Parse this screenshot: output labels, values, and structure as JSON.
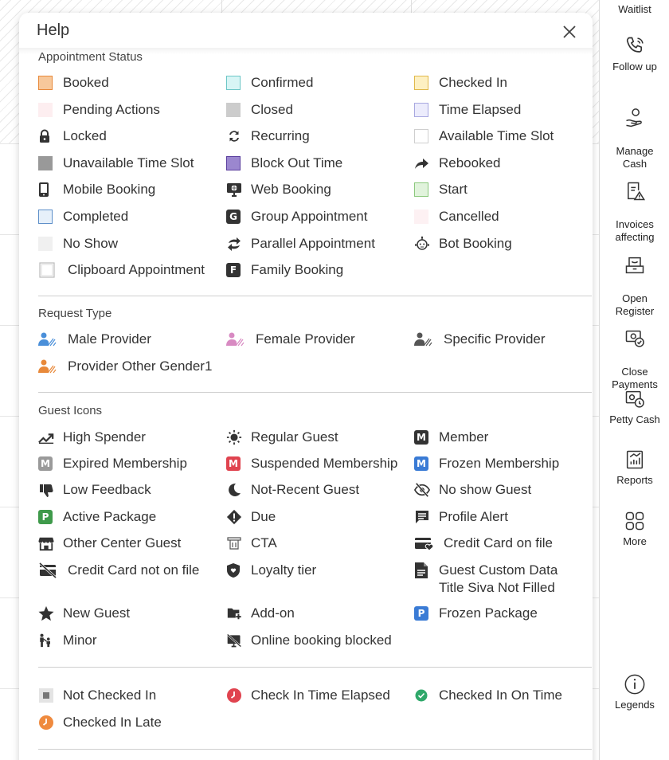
{
  "modal": {
    "title": "Help",
    "sections": {
      "appointment_status": {
        "title": "Appointment Status",
        "items": [
          {
            "label": "Booked",
            "swatch": "#f7c89b",
            "border": "#e8893a"
          },
          {
            "label": "Confirmed",
            "swatch": "#d8f5f5",
            "border": "#6cc6c6"
          },
          {
            "label": "Checked In",
            "swatch": "#fdf0c2",
            "border": "#e0b84a"
          },
          {
            "label": "Pending Actions",
            "swatch": "#fdeef0",
            "border": "#fdeef0"
          },
          {
            "label": "Closed",
            "swatch": "#cccccc",
            "border": "#cccccc"
          },
          {
            "label": "Time Elapsed",
            "swatch": "#ececfc",
            "border": "#a8a8e0"
          },
          {
            "label": "Locked",
            "icon": "lock-icon"
          },
          {
            "label": "Recurring",
            "icon": "recurring-icon"
          },
          {
            "label": "Available Time Slot",
            "swatch": "#ffffff",
            "border": "#cfcfcf"
          },
          {
            "label": "Unavailable Time Slot",
            "swatch": "#999999",
            "border": "#999999"
          },
          {
            "label": "Block Out Time",
            "swatch": "#9b87cf",
            "border": "#5b3f9e"
          },
          {
            "label": "Rebooked",
            "icon": "rebooked-arrow-icon"
          },
          {
            "label": "Mobile Booking",
            "icon": "mobile-icon"
          },
          {
            "label": "Web Booking",
            "icon": "web-monitor-icon"
          },
          {
            "label": "Start",
            "swatch": "#e1f3dc",
            "border": "#8cc87d"
          },
          {
            "label": "Completed",
            "swatch": "#e6f0fa",
            "border": "#5d8fc9"
          },
          {
            "label": "Group Appointment",
            "icon": "group-g-icon"
          },
          {
            "label": "Cancelled",
            "swatch": "#fdf1f3",
            "border": "#fdf1f3"
          },
          {
            "label": "No Show",
            "swatch": "#f0f0f0",
            "border": "#f0f0f0"
          },
          {
            "label": "Parallel Appointment",
            "icon": "parallel-arrows-icon"
          },
          {
            "label": "Bot Booking",
            "icon": "bot-icon"
          },
          {
            "label": "Clipboard Appointment",
            "icon": "clipboard-icon"
          },
          {
            "label": "Family Booking",
            "icon": "family-f-icon"
          }
        ]
      },
      "request_type": {
        "title": "Request Type",
        "items": [
          {
            "label": "Male Provider",
            "color": "#4a8fd9"
          },
          {
            "label": "Female Provider",
            "color": "#d88ac2"
          },
          {
            "label": "Specific Provider",
            "color": "#555555"
          },
          {
            "label": "Provider Other Gender1",
            "color": "#e8893a"
          }
        ]
      },
      "guest_icons": {
        "title": "Guest Icons",
        "items": [
          {
            "label": "High Spender",
            "icon": "trending-up-icon"
          },
          {
            "label": "Regular Guest",
            "icon": "sun-icon"
          },
          {
            "label": "Member",
            "icon": "member-m-icon",
            "color": "#333333",
            "letter": "M"
          },
          {
            "label": "Expired Membership",
            "icon": "expired-membership-icon",
            "color": "#9a9a9a",
            "letter": "M"
          },
          {
            "label": "Suspended Membership",
            "icon": "suspended-membership-icon",
            "color": "#e0434f",
            "letter": "M"
          },
          {
            "label": "Frozen Membership",
            "icon": "frozen-membership-icon",
            "color": "#3a7bd5",
            "letter": "M"
          },
          {
            "label": "Low Feedback",
            "icon": "thumbs-down-icon"
          },
          {
            "label": "Not-Recent Guest",
            "icon": "moon-icon"
          },
          {
            "label": "No show Guest",
            "icon": "eye-off-icon"
          },
          {
            "label": "Active Package",
            "icon": "active-package-icon",
            "color": "#3f9a4b",
            "letter": "P"
          },
          {
            "label": "Due",
            "icon": "due-alert-icon"
          },
          {
            "label": "Profile Alert",
            "icon": "comment-icon"
          },
          {
            "label": "Other Center Guest",
            "icon": "store-icon"
          },
          {
            "label": "CTA",
            "icon": "cta-icon"
          },
          {
            "label": "Credit Card on file",
            "icon": "credit-card-heart-icon"
          },
          {
            "label": "Credit Card not on file",
            "icon": "credit-card-off-icon"
          },
          {
            "label": "Loyalty tier",
            "icon": "loyalty-shield-icon"
          },
          {
            "label": "Guest Custom Data\nTitle Siva Not Filled",
            "icon": "document-icon"
          },
          {
            "label": "New Guest",
            "icon": "star-icon"
          },
          {
            "label": "Add-on",
            "icon": "add-on-icon"
          },
          {
            "label": "Frozen Package",
            "icon": "frozen-package-icon",
            "color": "#3a7bd5",
            "letter": "P"
          },
          {
            "label": "Minor",
            "icon": "minor-icon"
          },
          {
            "label": "Online booking blocked",
            "icon": "online-blocked-icon"
          }
        ]
      },
      "check_in": {
        "items": [
          {
            "label": "Not Checked In",
            "icon": "not-checked-in-icon"
          },
          {
            "label": "Check In Time Elapsed",
            "icon": "clock-red-icon",
            "color": "#e0434f"
          },
          {
            "label": "Checked In On Time",
            "icon": "check-green-icon",
            "color": "#2fa86a"
          },
          {
            "label": "Checked In Late",
            "icon": "clock-orange-icon",
            "color": "#ef8a3e"
          }
        ]
      }
    }
  },
  "rail": {
    "items": [
      {
        "label": "Waitlist"
      },
      {
        "label": "Follow up"
      },
      {
        "label": "Manage\nCash"
      },
      {
        "label": "Invoices\naffecting"
      },
      {
        "label": "Open\nRegister"
      },
      {
        "label": "Close\nPayments"
      },
      {
        "label": "Petty Cash"
      },
      {
        "label": "Reports"
      },
      {
        "label": "More"
      },
      {
        "label": "Legends"
      }
    ]
  }
}
